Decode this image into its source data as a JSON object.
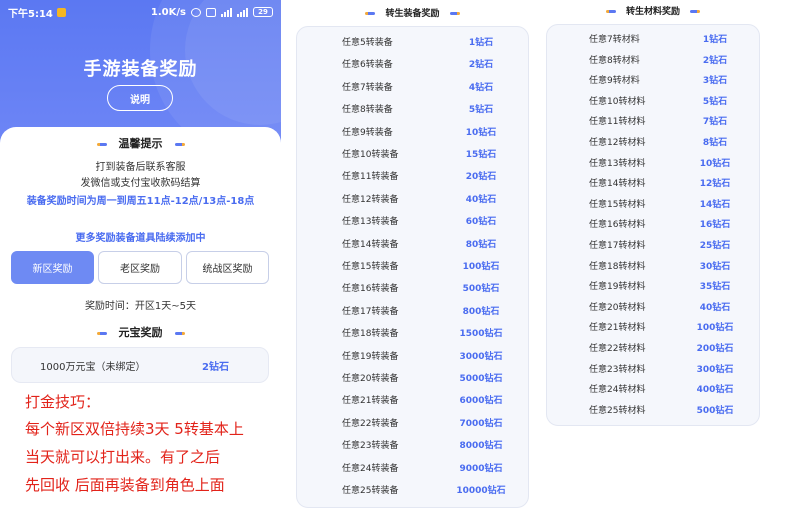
{
  "status_bar": {
    "time": "下午5:14",
    "speed": "1.0K/s",
    "battery": "29"
  },
  "header": {
    "title": "手游装备奖励",
    "explain_button": "说明"
  },
  "tips": {
    "title": "温馨提示",
    "line1": "打到装备后联系客服",
    "line2": "发微信或支付宝收款码结算",
    "line3": "装备奖励时间为周一到周五11点-12点/13点-18点",
    "line4": "更多奖励装备道具陆续添加中"
  },
  "tabs": [
    {
      "label": "新区奖励",
      "active": true
    },
    {
      "label": "老区奖励",
      "active": false
    },
    {
      "label": "统战区奖励",
      "active": false
    }
  ],
  "reward_time": "奖励时间：开区1天~5天",
  "yuanbao": {
    "title": "元宝奖励",
    "item": "1000万元宝（未绑定）",
    "value": "2钻石"
  },
  "strategy": {
    "line1": "打金技巧：",
    "line2": "每个新区双倍持续3天  5转基本上",
    "line3": "当天就可以打出来。有了之后",
    "line4": "先回收  后面再装备到角色上面"
  },
  "rebirth_equip": {
    "title": "转生装备奖励",
    "rows": [
      {
        "name": "任意5转装备",
        "value": "1钻石"
      },
      {
        "name": "任意6转装备",
        "value": "2钻石"
      },
      {
        "name": "任意7转装备",
        "value": "4钻石"
      },
      {
        "name": "任意8转装备",
        "value": "5钻石"
      },
      {
        "name": "任意9转装备",
        "value": "10钻石"
      },
      {
        "name": "任意10转装备",
        "value": "15钻石"
      },
      {
        "name": "任意11转装备",
        "value": "20钻石"
      },
      {
        "name": "任意12转装备",
        "value": "40钻石"
      },
      {
        "name": "任意13转装备",
        "value": "60钻石"
      },
      {
        "name": "任意14转装备",
        "value": "80钻石"
      },
      {
        "name": "任意15转装备",
        "value": "100钻石"
      },
      {
        "name": "任意16转装备",
        "value": "500钻石"
      },
      {
        "name": "任意17转装备",
        "value": "800钻石"
      },
      {
        "name": "任意18转装备",
        "value": "1500钻石"
      },
      {
        "name": "任意19转装备",
        "value": "3000钻石"
      },
      {
        "name": "任意20转装备",
        "value": "5000钻石"
      },
      {
        "name": "任意21转装备",
        "value": "6000钻石"
      },
      {
        "name": "任意22转装备",
        "value": "7000钻石"
      },
      {
        "name": "任意23转装备",
        "value": "8000钻石"
      },
      {
        "name": "任意24转装备",
        "value": "9000钻石"
      },
      {
        "name": "任意25转装备",
        "value": "10000钻石"
      }
    ]
  },
  "rebirth_material": {
    "title": "转生材料奖励",
    "rows": [
      {
        "name": "任意7转材料",
        "value": "1钻石"
      },
      {
        "name": "任意8转材料",
        "value": "2钻石"
      },
      {
        "name": "任意9转材料",
        "value": "3钻石"
      },
      {
        "name": "任意10转材料",
        "value": "5钻石"
      },
      {
        "name": "任意11转材料",
        "value": "7钻石"
      },
      {
        "name": "任意12转材料",
        "value": "8钻石"
      },
      {
        "name": "任意13转材料",
        "value": "10钻石"
      },
      {
        "name": "任意14转材料",
        "value": "12钻石"
      },
      {
        "name": "任意15转材料",
        "value": "14钻石"
      },
      {
        "name": "任意16转材料",
        "value": "16钻石"
      },
      {
        "name": "任意17转材料",
        "value": "25钻石"
      },
      {
        "name": "任意18转材料",
        "value": "30钻石"
      },
      {
        "name": "任意19转材料",
        "value": "35钻石"
      },
      {
        "name": "任意20转材料",
        "value": "40钻石"
      },
      {
        "name": "任意21转材料",
        "value": "100钻石"
      },
      {
        "name": "任意22转材料",
        "value": "200钻石"
      },
      {
        "name": "任意23转材料",
        "value": "300钻石"
      },
      {
        "name": "任意24转材料",
        "value": "400钻石"
      },
      {
        "name": "任意25转材料",
        "value": "500钻石"
      }
    ]
  },
  "colors": {
    "brand_blue": "#5b78f2",
    "value_blue": "#4a6cf0",
    "accent_orange": "#f3a93a",
    "strategy_red": "#e2231a"
  }
}
